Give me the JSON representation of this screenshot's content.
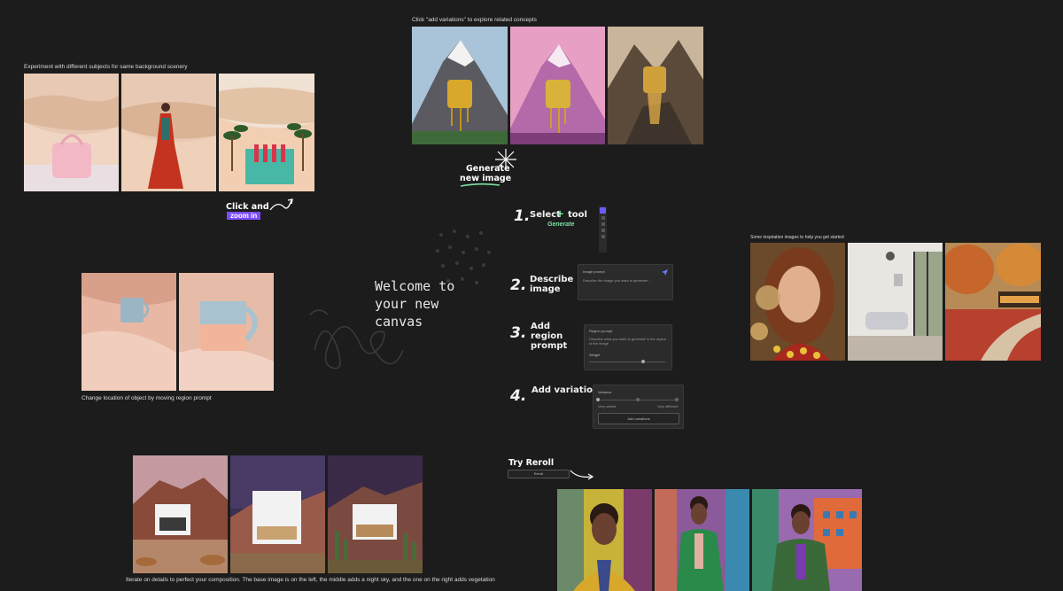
{
  "captions": {
    "subjects": "Experiment with different subjects for same background scenery",
    "variations": "Click \"add variations\" to explore related concepts",
    "inspiration": "Some inspiration images to help you get started",
    "location": "Change location of object by moving region prompt",
    "iterate": "Iterate on details to perfect your composition. The base image is on the left, the middle adds a night sky, and the one on the right adds vegetation"
  },
  "annotations": {
    "click_and": "Click and",
    "zoom_in": "zoom in",
    "generate_line1": "Generate",
    "generate_line2": "new image",
    "try_reroll": "Try Reroll",
    "reroll_button": "Reroll"
  },
  "welcome": {
    "text": "Welcome to your new canvas"
  },
  "steps": [
    {
      "number": "1.",
      "title": "Select",
      "title_suffix": "tool",
      "sub": "Generate"
    },
    {
      "number": "2.",
      "title": "Describe image"
    },
    {
      "number": "3.",
      "title": "Add region prompt"
    },
    {
      "number": "4.",
      "title": "Add variation"
    }
  ],
  "panels": {
    "image_prompt": {
      "label": "Image prompt",
      "placeholder": "Describe the image you want to generate..."
    },
    "region_prompt": {
      "label": "Region prompt",
      "placeholder": "Describe what you want to generate in the region of the image",
      "weight_label": "Weight"
    },
    "variation": {
      "label": "Variance",
      "left": "Very similar",
      "right": "Very different",
      "button": "Add variations"
    }
  },
  "colors": {
    "background": "#1c1c1c",
    "accent_purple": "#7b4cff",
    "accent_green": "#7fe0a0"
  },
  "icons": [
    "plus-icon",
    "send-icon",
    "sparkle-icon",
    "arrow-icon",
    "info-icon"
  ]
}
